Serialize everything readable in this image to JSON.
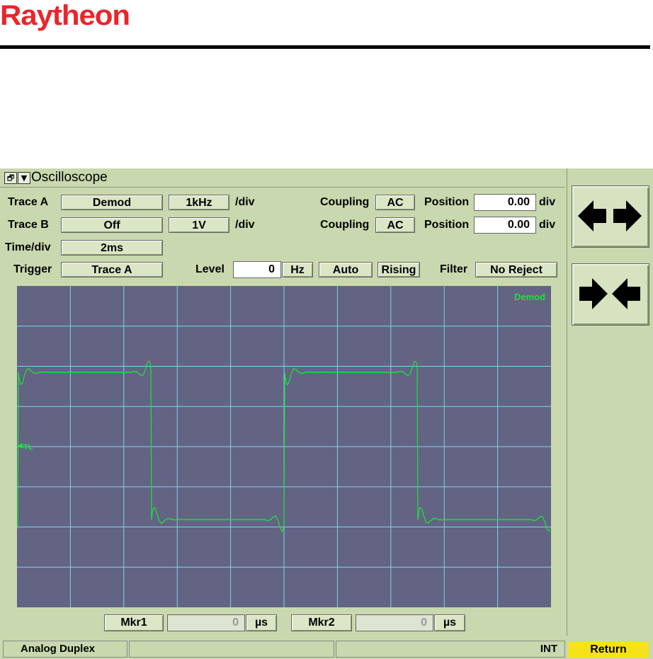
{
  "header": {
    "logo_text": "Raytheon"
  },
  "window": {
    "title": "Oscilloscope",
    "restore_icon": "restore-icon",
    "menu_icon": "dropdown-triangle-icon"
  },
  "trace_a": {
    "label": "Trace A",
    "source": "Demod",
    "scale": "1kHz",
    "per_div": "/div",
    "coupling_label": "Coupling",
    "coupling": "AC",
    "position_label": "Position",
    "position": "0.00",
    "position_unit": "div"
  },
  "trace_b": {
    "label": "Trace B",
    "source": "Off",
    "scale": "1V",
    "per_div": "/div",
    "coupling_label": "Coupling",
    "coupling": "AC",
    "position_label": "Position",
    "position": "0.00",
    "position_unit": "div"
  },
  "timebase": {
    "label": "Time/div",
    "value": "2ms"
  },
  "trigger": {
    "label": "Trigger",
    "source": "Trace A",
    "level_label": "Level",
    "level": "0",
    "level_unit": "Hz",
    "mode": "Auto",
    "slope": "Rising",
    "filter_label": "Filter",
    "filter": "No Reject"
  },
  "display": {
    "trace_label": "Demod",
    "trigger_marker": "TL",
    "h_divisions": 10,
    "v_divisions": 8,
    "bg_color": "#636384",
    "grid_color": "#7fd3e8",
    "trace_color": "#19e43a"
  },
  "markers": {
    "mkr1_label": "Mkr1",
    "mkr1_value": "0",
    "mkr1_unit": "µs",
    "mkr2_label": "Mkr2",
    "mkr2_value": "0",
    "mkr2_unit": "µs"
  },
  "side": {
    "expand_icon": "arrows-outward-icon",
    "compress_icon": "arrows-inward-icon"
  },
  "status": {
    "mode": "Analog Duplex",
    "segment2": "",
    "ref": "INT",
    "return_label": "Return"
  },
  "colors": {
    "panel": "#c9d8ae",
    "logo": "#e8262b",
    "return": "#f7e21a"
  }
}
